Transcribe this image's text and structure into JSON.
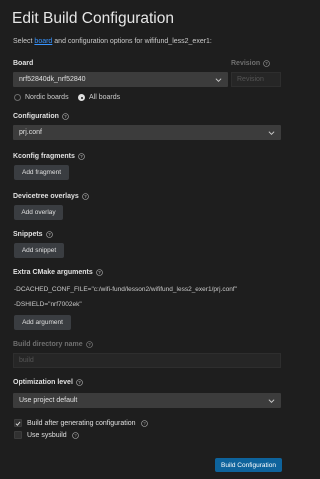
{
  "page": {
    "title": "Edit Build Configuration",
    "subtitle_prefix": "Select",
    "subtitle_link": "board",
    "subtitle_suffix": "and configuration options for wififund_less2_exer1:"
  },
  "board": {
    "label": "Board",
    "value": "nrf52840dk_nrf52840",
    "revision_label": "Revision",
    "revision_placeholder": "Revision",
    "radio_nordic": "Nordic boards",
    "radio_all": "All boards",
    "selected_radio": "All boards"
  },
  "configuration": {
    "label": "Configuration",
    "value": "prj.conf"
  },
  "kconfig": {
    "label": "Kconfig fragments",
    "button": "Add fragment"
  },
  "devicetree": {
    "label": "Devicetree overlays",
    "button": "Add overlay"
  },
  "snippets": {
    "label": "Snippets",
    "button": "Add snippet"
  },
  "cmake": {
    "label": "Extra CMake arguments",
    "args": [
      "-DCACHED_CONF_FILE=\"c:/wifi-fund/lesson2/wififund_less2_exer1/prj.conf\"",
      "-DSHIELD=\"nrf7002ek\""
    ],
    "button": "Add argument"
  },
  "build_dir": {
    "label": "Build directory name",
    "placeholder": "build"
  },
  "optimization": {
    "label": "Optimization level",
    "value": "Use project default"
  },
  "options": {
    "build_after": "Build after generating configuration",
    "build_after_checked": true,
    "sysbuild": "Use sysbuild",
    "sysbuild_checked": false
  },
  "footer": {
    "primary_button": "Build Configuration"
  },
  "colors": {
    "background": "#1e1e1e",
    "link": "#3794ff",
    "primary": "#0e639c",
    "input": "#3c3c3c"
  }
}
